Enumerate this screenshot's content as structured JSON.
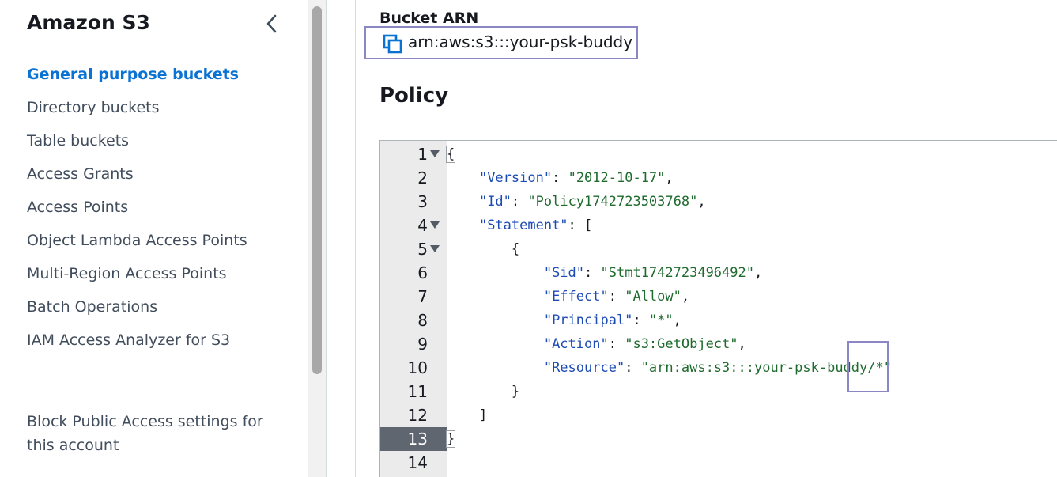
{
  "sidebar": {
    "title": "Amazon S3",
    "items": [
      {
        "label": "General purpose buckets",
        "active": true
      },
      {
        "label": "Directory buckets"
      },
      {
        "label": "Table buckets"
      },
      {
        "label": "Access Grants"
      },
      {
        "label": "Access Points"
      },
      {
        "label": "Object Lambda Access Points"
      },
      {
        "label": "Multi-Region Access Points"
      },
      {
        "label": "Batch Operations"
      },
      {
        "label": "IAM Access Analyzer for S3"
      }
    ],
    "footer_link": "Block Public Access settings for this account"
  },
  "main": {
    "bucket_arn_label": "Bucket ARN",
    "bucket_arn_value": "arn:aws:s3:::your-psk-buddy",
    "policy_heading": "Policy"
  },
  "editor": {
    "active_line": 13,
    "lines": [
      {
        "n": "1",
        "text": "{"
      },
      {
        "n": "2",
        "text": "    \"Version\": \"2012-10-17\","
      },
      {
        "n": "3",
        "text": "    \"Id\": \"Policy1742723503768\","
      },
      {
        "n": "4",
        "text": "    \"Statement\": ["
      },
      {
        "n": "5",
        "text": "        {"
      },
      {
        "n": "6",
        "text": "            \"Sid\": \"Stmt1742723496492\","
      },
      {
        "n": "7",
        "text": "            \"Effect\": \"Allow\","
      },
      {
        "n": "8",
        "text": "            \"Principal\": \"*\","
      },
      {
        "n": "9",
        "text": "            \"Action\": \"s3:GetObject\","
      },
      {
        "n": "10",
        "text": "            \"Resource\": \"arn:aws:s3:::your-psk-buddy/*\""
      },
      {
        "n": "11",
        "text": "        }"
      },
      {
        "n": "12",
        "text": "    ]"
      },
      {
        "n": "13",
        "text": "}"
      },
      {
        "n": "14",
        "text": ""
      }
    ]
  },
  "colors": {
    "accent": "#0972d3",
    "annotation": "#8b86c6",
    "json_key": "#1d4bb5",
    "json_string": "#1f6b2e"
  }
}
